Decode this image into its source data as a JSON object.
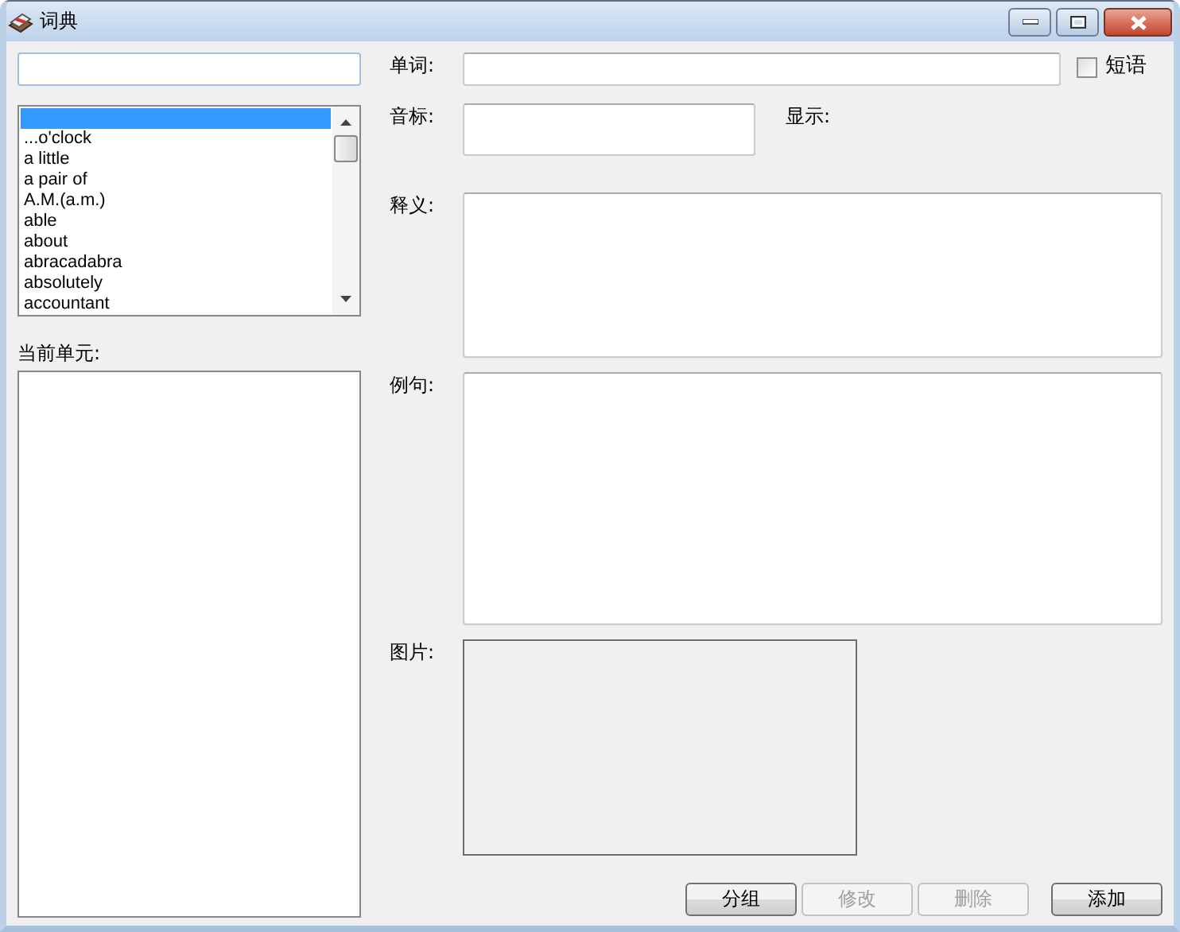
{
  "window": {
    "title": "词典"
  },
  "word_list": {
    "items": [
      {
        "selected": true
      },
      {
        "text": "...o'clock",
        "selected": false
      },
      {
        "text": "a little",
        "selected": false
      },
      {
        "text": "a pair of",
        "selected": false
      },
      {
        "text": "A.M.(a.m.)",
        "selected": false
      },
      {
        "text": "able",
        "selected": false
      },
      {
        "text": "about",
        "selected": false
      },
      {
        "text": "abracadabra",
        "selected": false
      },
      {
        "text": "absolutely",
        "selected": false
      },
      {
        "text": "accountant",
        "selected": false
      }
    ]
  },
  "current_unit_label": "当前单元:",
  "word_label": "单词:",
  "phrase_checkbox": {
    "label": "短语",
    "checked": false
  },
  "phonetic_label": "音标:",
  "display_label": "显示:",
  "meaning_label": "释义:",
  "example_label": "例句:",
  "picture_label": "图片:",
  "buttons": [
    {
      "label": "分组",
      "disabled": false
    },
    {
      "label": "修改",
      "disabled": true
    },
    {
      "label": "删除",
      "disabled": true
    },
    {
      "label": "添加",
      "disabled": false
    }
  ]
}
